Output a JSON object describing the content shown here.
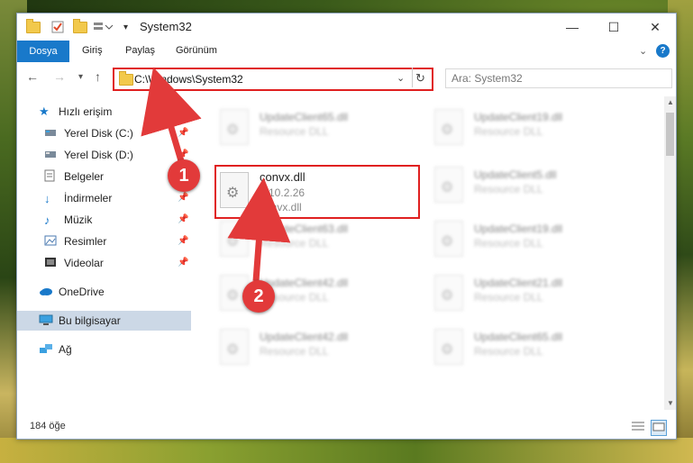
{
  "window": {
    "title": "System32",
    "controls": {
      "minimize": "—",
      "maximize": "☐",
      "close": "✕"
    }
  },
  "ribbon": {
    "tabs": [
      "Dosya",
      "Giriş",
      "Paylaş",
      "Görünüm"
    ],
    "file_tab": "Dosya",
    "help": "?"
  },
  "nav": {
    "address": "C:\\Windows\\System32",
    "search_placeholder": "Ara: System32"
  },
  "sidebar": {
    "quick_access": "Hızlı erişim",
    "items": [
      "Yerel Disk (C:)",
      "Yerel Disk (D:)",
      "Belgeler",
      "İndirmeler",
      "Müzik",
      "Resimler",
      "Videolar"
    ],
    "onedrive": "OneDrive",
    "this_pc": "Bu bilgisayar",
    "network": "Ağ"
  },
  "files": [
    {
      "name": "UpdateClient65.dll",
      "desc": "Resource DLL"
    },
    {
      "name": "UpdateClient19.dll",
      "desc": "Resource DLL"
    },
    {
      "name": "UpdateClient5.dll",
      "desc": "Resource DLL"
    },
    {
      "name": "UpdateClient63.dll",
      "desc": "Resource DLL"
    },
    {
      "name": "UpdateClient19.dll",
      "desc": "Resource DLL"
    },
    {
      "name": "UpdateClient42.dll",
      "desc": "Resource DLL"
    },
    {
      "name": "UpdateClient21.dll",
      "desc": "Resource DLL"
    },
    {
      "name": "UpdateClient42.dll",
      "desc": "Resource DLL"
    },
    {
      "name": "UpdateClient65.dll",
      "desc": "Resource DLL"
    }
  ],
  "highlighted_file": {
    "name": "convx.dll",
    "version": "8.10.2.26",
    "desc": "convx.dll"
  },
  "status": {
    "count": "184 öğe"
  },
  "annotations": {
    "step1": "1",
    "step2": "2"
  },
  "colors": {
    "accent": "#1979ca",
    "highlight": "#e02020",
    "badge": "#e23a3a"
  }
}
